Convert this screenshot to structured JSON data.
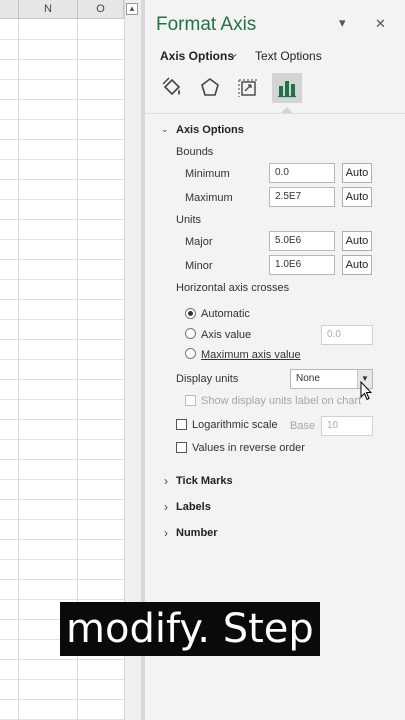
{
  "sheet": {
    "columns": [
      "N",
      "O"
    ],
    "scroll_up": "▲"
  },
  "pane": {
    "title": "Format Axis",
    "menu_glyph": "▾",
    "close_glyph": "✕",
    "tabs": [
      {
        "label": "Axis Options",
        "chevron": "⌄"
      },
      {
        "label": "Text Options"
      }
    ],
    "icons": [
      "fill-line-icon",
      "effects-icon",
      "size-properties-icon",
      "axis-options-icon"
    ]
  },
  "axis_options": {
    "header": "Axis Options",
    "expand": "⌄",
    "bounds": {
      "label": "Bounds",
      "minimum": {
        "label": "Minimum",
        "value": "0.0",
        "auto": "Auto"
      },
      "maximum": {
        "label": "Maximum",
        "value": "2.5E7",
        "auto": "Auto"
      }
    },
    "units": {
      "label": "Units",
      "major": {
        "label": "Major",
        "value": "5.0E6",
        "auto": "Auto"
      },
      "minor": {
        "label": "Minor",
        "value": "1.0E6",
        "auto": "Auto"
      }
    },
    "crosses": {
      "label": "Horizontal axis crosses",
      "options": [
        "Automatic",
        "Axis value",
        "Maximum axis value"
      ],
      "selected": "Automatic",
      "axis_value": "0.0"
    },
    "display_units": {
      "label": "Display units",
      "selected": "None",
      "show_label": "Show display units label on chart"
    },
    "log_scale": {
      "label": "Logarithmic scale",
      "base_label": "Base",
      "base_value": "10"
    },
    "reverse": {
      "label": "Values in reverse order"
    }
  },
  "sections": [
    {
      "label": "Tick Marks",
      "chevron": "›"
    },
    {
      "label": "Labels",
      "chevron": "›"
    },
    {
      "label": "Number",
      "chevron": "›"
    }
  ],
  "caption": "modify. Step",
  "colors": {
    "accent": "#217346",
    "pane_bg": "#f3f3f3",
    "caption_bg": "#0a0a0a"
  }
}
